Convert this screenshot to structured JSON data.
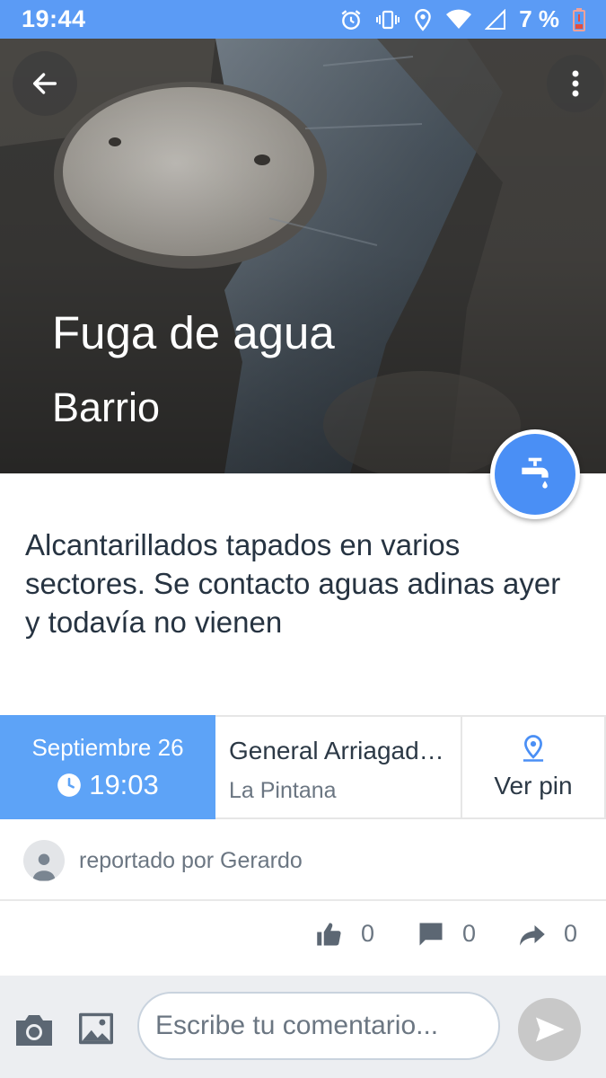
{
  "status_bar": {
    "time": "19:44",
    "battery_percent": "7 %",
    "icons": [
      "alarm-icon",
      "vibrate-icon",
      "location-icon",
      "wifi-icon",
      "signal-icon",
      "battery-low-icon"
    ]
  },
  "report": {
    "title": "Fuga de agua",
    "subtitle": "Barrio",
    "category_icon": "water-faucet-icon",
    "description": "Alcantarillados tapados en varios sectores. Se contacto aguas adinas ayer y todavía no vienen",
    "date": "Septiembre 26",
    "time": "19:03",
    "street": "General Arriagad…",
    "commune": "La Pintana",
    "pin_label": "Ver pin",
    "reporter": "reportado por Gerardo"
  },
  "actions": {
    "likes": "0",
    "comments": "0",
    "shares": "0"
  },
  "comment": {
    "placeholder": "Escribe tu comentario..."
  },
  "colors": {
    "accent": "#5b9bf5",
    "date_box": "#5da3f7",
    "category": "#4a8ff5",
    "text": "#263341"
  }
}
